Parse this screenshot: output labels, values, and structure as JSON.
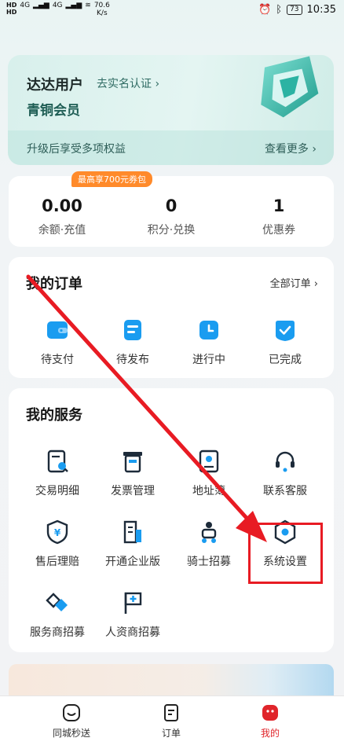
{
  "status_bar": {
    "hd_top": "HD",
    "hd_bottom": "HD",
    "signal": "4G",
    "speed": "70.6",
    "speed_unit": "K/s",
    "battery": "73",
    "time": "10:35"
  },
  "member": {
    "user_name": "达达用户",
    "verify_link": "去实名认证 ›",
    "level": "青铜会员",
    "upgrade_text": "升级后享受多项权益",
    "more_link": "查看更多 ›"
  },
  "wallet": {
    "promo_badge": "最高享700元券包",
    "items": [
      {
        "value": "0.00",
        "label": "余额·充值"
      },
      {
        "value": "0",
        "label": "积分·兑换"
      },
      {
        "value": "1",
        "label": "优惠券"
      }
    ]
  },
  "orders": {
    "title": "我的订单",
    "all_link": "全部订单 ›",
    "items": [
      {
        "label": "待支付",
        "icon": "wallet-icon"
      },
      {
        "label": "待发布",
        "icon": "document-icon"
      },
      {
        "label": "进行中",
        "icon": "clock-icon"
      },
      {
        "label": "已完成",
        "icon": "check-icon"
      }
    ]
  },
  "services": {
    "title": "我的服务",
    "items": [
      {
        "label": "交易明细",
        "icon": "receipt-search-icon"
      },
      {
        "label": "发票管理",
        "icon": "invoice-icon"
      },
      {
        "label": "地址簿",
        "icon": "address-book-icon"
      },
      {
        "label": "联系客服",
        "icon": "headset-icon"
      },
      {
        "label": "售后理赔",
        "icon": "yen-shield-icon"
      },
      {
        "label": "开通企业版",
        "icon": "building-icon"
      },
      {
        "label": "骑士招募",
        "icon": "rider-icon"
      },
      {
        "label": "系统设置",
        "icon": "settings-hex-icon"
      },
      {
        "label": "服务商招募",
        "icon": "handshake-icon"
      },
      {
        "label": "人资商招募",
        "icon": "flag-plus-icon"
      }
    ]
  },
  "tabbar": {
    "tabs": [
      {
        "label": "同城秒送",
        "icon": "smile-bag-icon"
      },
      {
        "label": "订单",
        "icon": "order-list-icon"
      },
      {
        "label": "我的",
        "icon": "profile-icon"
      }
    ],
    "active": "我的"
  },
  "colors": {
    "accent_blue": "#1a9cf0",
    "teal": "#2bb3a3",
    "annotation_red": "#e81b23",
    "promo_orange": "#ff8a2a"
  }
}
